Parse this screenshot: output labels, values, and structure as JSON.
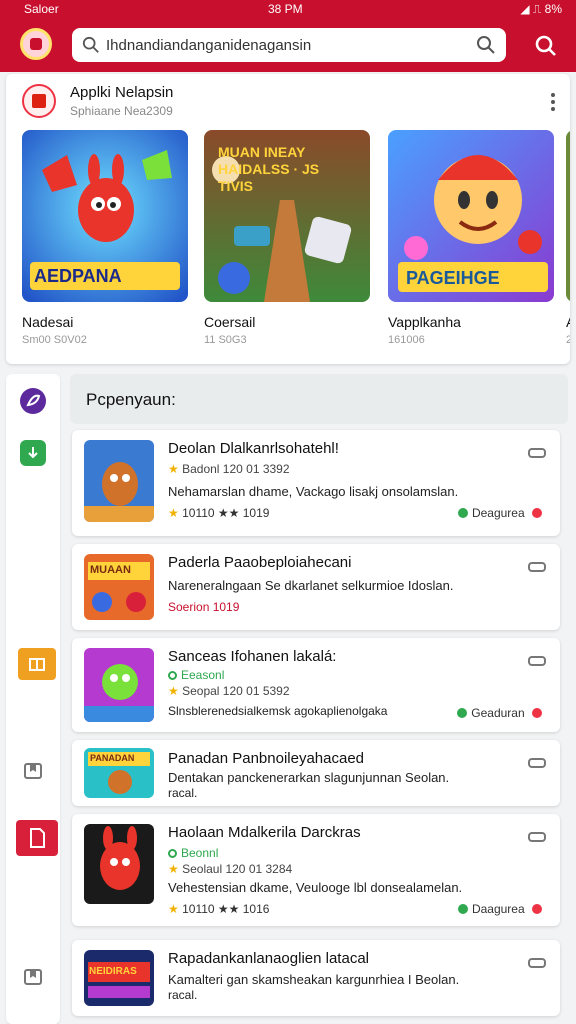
{
  "status": {
    "left": "Saloer",
    "time": "38 PM",
    "right": "◢ ⎍ 8%"
  },
  "search": {
    "value": "Ihdnandiandanganidenagansin",
    "placeholder": "Search"
  },
  "featured": {
    "title": "Applki Nelapsin",
    "subtitle": "Sphiaane Nea2309",
    "items": [
      {
        "label": "Nadesai",
        "meta": "Sm00 S0V02",
        "art": "AEDPANA"
      },
      {
        "label": "Coersail",
        "meta": "11 S0G3",
        "art": "MUAN INEAY HAIDALSS · JS TIVIS"
      },
      {
        "label": "Vapplkanha",
        "meta": "161006",
        "art": "PAGEIHGE"
      },
      {
        "label": "A",
        "meta": "2",
        "art": ""
      }
    ]
  },
  "panel": {
    "heading": "Pcpenyaun:",
    "cards": [
      {
        "title": "Deolan Dlalkanrlsohatehl!",
        "sub": "Badonl  120 01 3392",
        "desc": "Nehamarslan dhame, Vackago lisakj onsolamslan.",
        "foot": "10110 ★★ 1019",
        "action": "Deagurea",
        "art": "game1"
      },
      {
        "title": "Paderla Paaobeploiahecani",
        "sub": "",
        "desc": "Nareneralngaan Se dkarlanet selkurmioe Idoslan.",
        "foot": "Soerion  1019",
        "action": "",
        "art": "MUAAN"
      },
      {
        "title": "Sanceas Ifohanen lakalá:",
        "sub": "Eeasonl",
        "sub2": "Seopal  120 01 5392",
        "desc": "Slnsblerenedsialkemsk agokaplienolgaka",
        "foot": "",
        "action": "Geaduran",
        "art": "game3"
      },
      {
        "title": "Panadan Panbnoileyahacaed",
        "sub": "",
        "desc": "Dentakan panckenerarkan slagunjunnan Seolan.",
        "desc2": "racal.",
        "foot": "",
        "action": "",
        "art": "PANADAN"
      },
      {
        "title": "Haolaan Mdalkerila Darckras",
        "sub": "Beonnl",
        "sub2": "Seolaul  120 01 3284",
        "desc": "Vehestensian dkame, Veulooge lbl donsealamelan.",
        "foot": "10110 ★★ 1016",
        "action": "Daagurea",
        "art": "game5"
      },
      {
        "title": "Rapadankanlanaoglien latacal",
        "sub": "",
        "desc": "Kamalteri gan skamsheakan kargunrhiea I Beolan.",
        "desc2": "racal.",
        "foot": "",
        "action": "",
        "art": "NEIDIRAS"
      }
    ]
  },
  "colors": {
    "brand": "#c8102e",
    "rail_purple": "#5c2a9d",
    "rail_green": "#2fa84f",
    "rail_orange": "#f0a020",
    "rail_red": "#d8203a"
  }
}
